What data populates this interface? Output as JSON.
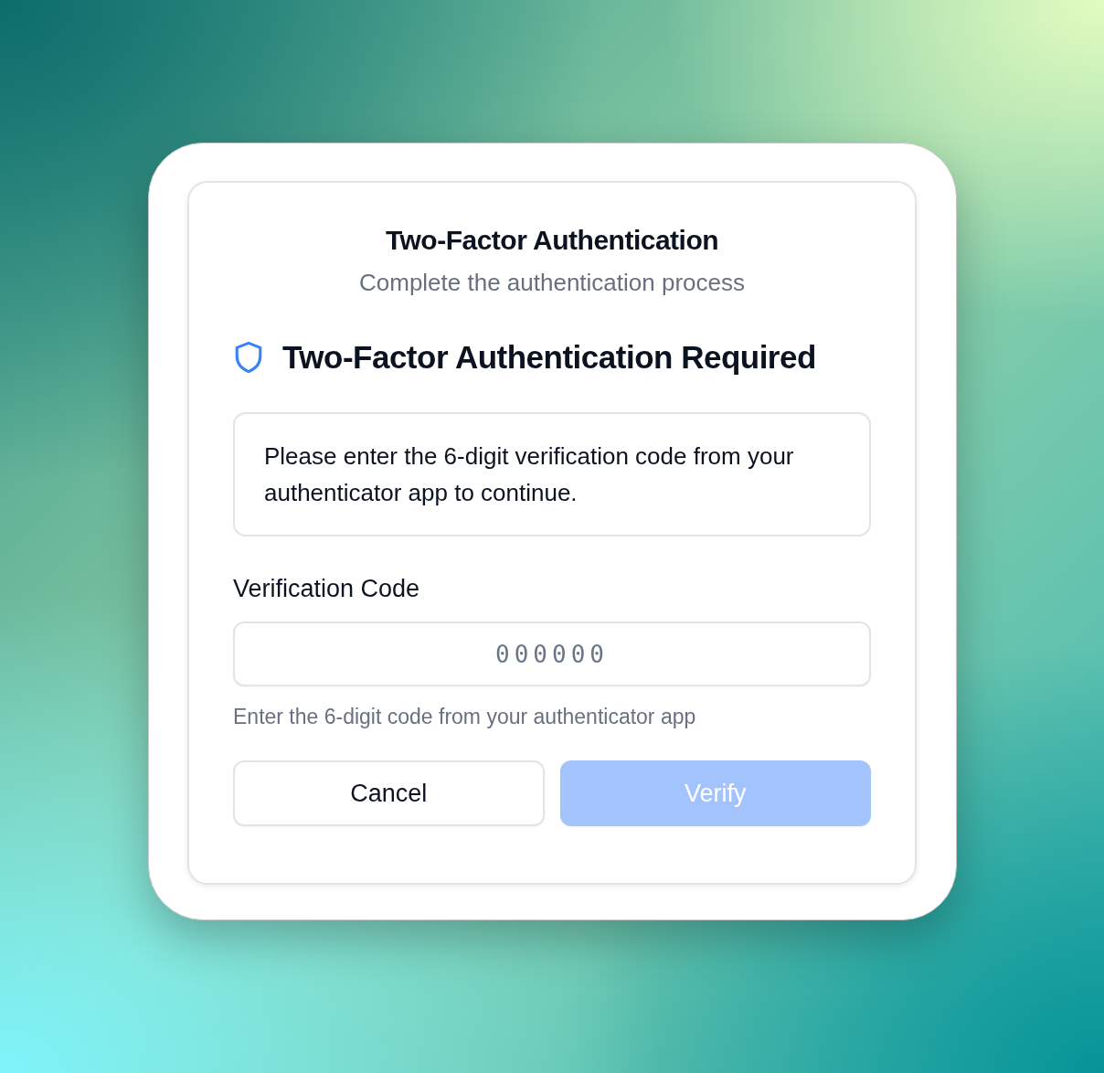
{
  "dialog": {
    "title": "Two-Factor Authentication",
    "subtitle": "Complete the authentication process"
  },
  "notice": {
    "heading": "Two-Factor Authentication Required",
    "message": "Please enter the 6-digit verification code from your authenticator app to continue."
  },
  "field": {
    "label": "Verification Code",
    "placeholder": "000000",
    "helper": "Enter the 6-digit code from your authenticator app"
  },
  "buttons": [
    {
      "label": "Cancel",
      "kind": "secondary",
      "disabled": false
    },
    {
      "label": "Verify",
      "kind": "primary",
      "disabled": true
    }
  ]
}
